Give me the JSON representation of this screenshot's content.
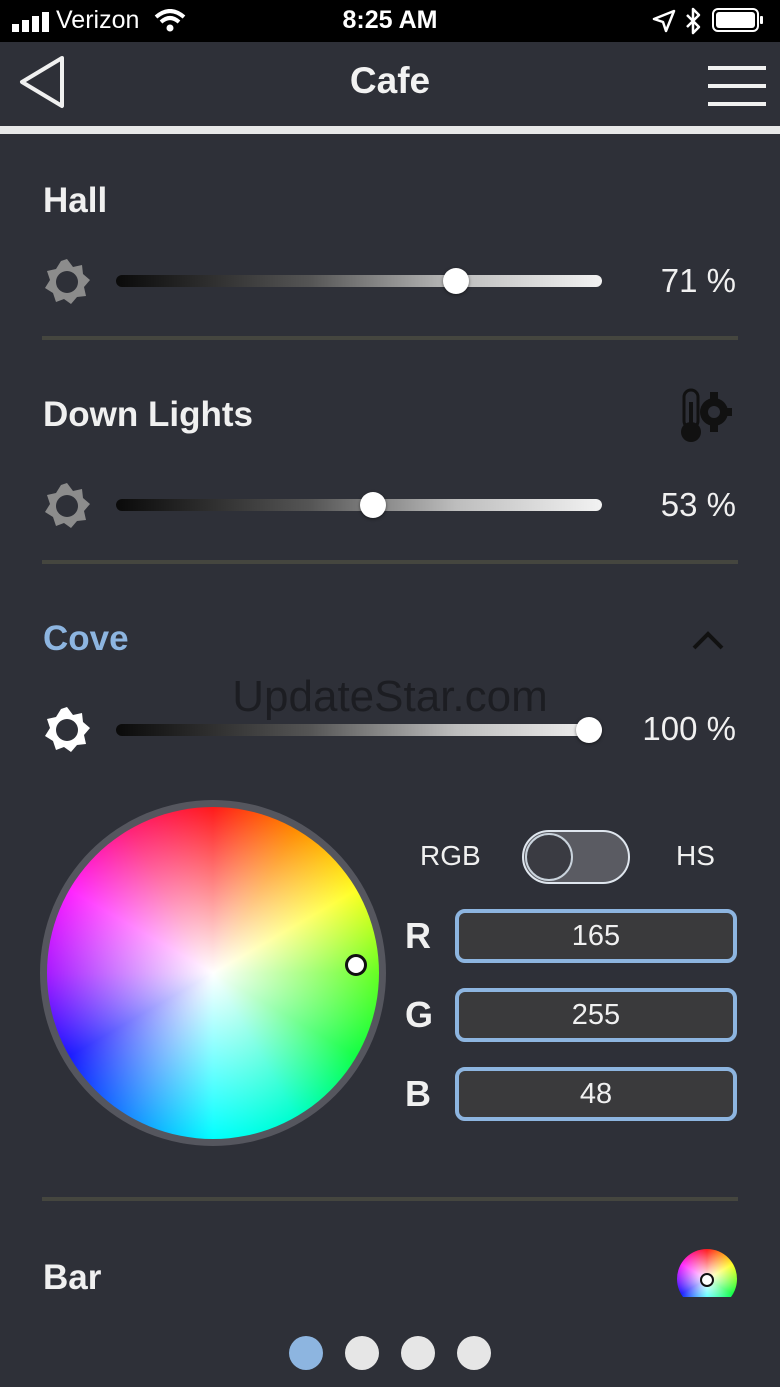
{
  "status_bar": {
    "carrier": "Verizon",
    "time": "8:25 AM"
  },
  "nav": {
    "title": "Cafe"
  },
  "zones": {
    "hall": {
      "title": "Hall",
      "level_text": "71 %",
      "level": 71
    },
    "down_lights": {
      "title": "Down Lights",
      "level_text": "53 %",
      "level": 53
    },
    "cove": {
      "title": "Cove",
      "level_text": "100 %",
      "level": 100
    },
    "bar": {
      "title": "Bar"
    }
  },
  "watermark": "UpdateStar.com",
  "color_panel": {
    "mode_left": "RGB",
    "mode_right": "HS",
    "channels": [
      {
        "label": "R",
        "value": "165"
      },
      {
        "label": "G",
        "value": "255"
      },
      {
        "label": "B",
        "value": "48"
      }
    ]
  },
  "pager": {
    "pages": 4,
    "active": 1
  },
  "colors": {
    "background": "#2e3038",
    "accent": "#8db5e0",
    "divider": "#45463f"
  },
  "icons": [
    "signal-icon",
    "wifi-icon",
    "location-icon",
    "bluetooth-icon",
    "battery-icon",
    "back-icon",
    "menu-icon",
    "brightness-icon",
    "thermometer-gear-icon",
    "chevron-up-icon",
    "color-wheel-icon"
  ]
}
